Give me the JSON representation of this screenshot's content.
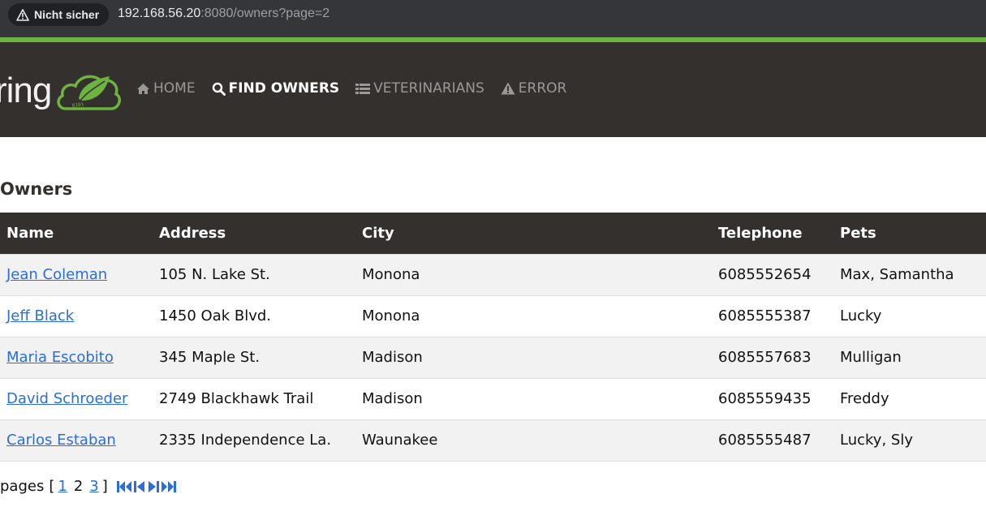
{
  "browser": {
    "security_label": "Nicht sicher",
    "url_host": "192.168.56.20",
    "url_rest": ":8080/owners?page=2"
  },
  "navbar": {
    "logo_text": "ring",
    "items": [
      {
        "label": "HOME",
        "icon": "home-icon",
        "active": false
      },
      {
        "label": "FIND OWNERS",
        "icon": "search-icon",
        "active": true
      },
      {
        "label": "VETERINARIANS",
        "icon": "list-icon",
        "active": false
      },
      {
        "label": "ERROR",
        "icon": "warning-icon",
        "active": false
      }
    ]
  },
  "page": {
    "title": "Owners"
  },
  "table": {
    "headers": [
      "Name",
      "Address",
      "City",
      "Telephone",
      "Pets"
    ],
    "rows": [
      {
        "name": "Jean Coleman",
        "address": "105 N. Lake St.",
        "city": "Monona",
        "telephone": "6085552654",
        "pets": "Max, Samantha"
      },
      {
        "name": "Jeff Black",
        "address": "1450 Oak Blvd.",
        "city": "Monona",
        "telephone": "6085555387",
        "pets": "Lucky"
      },
      {
        "name": "Maria Escobito",
        "address": "345 Maple St.",
        "city": "Madison",
        "telephone": "6085557683",
        "pets": "Mulligan"
      },
      {
        "name": "David Schroeder",
        "address": "2749 Blackhawk Trail",
        "city": "Madison",
        "telephone": "6085559435",
        "pets": "Freddy"
      },
      {
        "name": "Carlos Estaban",
        "address": "2335 Independence La.",
        "city": "Waunakee",
        "telephone": "6085555487",
        "pets": "Lucky, Sly"
      }
    ]
  },
  "pager": {
    "label": "pages",
    "open_bracket": "[",
    "close_bracket": "]",
    "page1": "1",
    "page2": "2",
    "page3": "3",
    "current_page": 2
  },
  "colors": {
    "nav_bg": "#34302d",
    "accent_green": "#6db33f",
    "link_blue": "#2a6ed8"
  }
}
